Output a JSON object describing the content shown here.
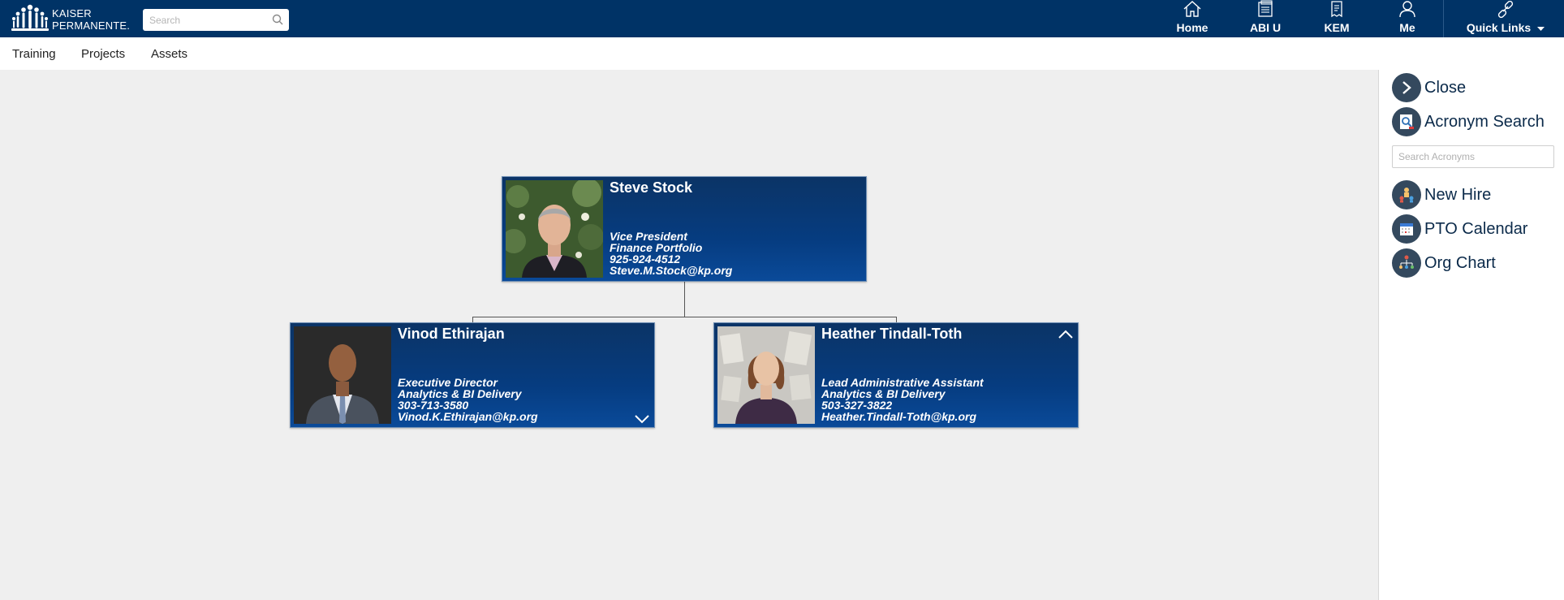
{
  "header": {
    "logo_line1": "KAISER",
    "logo_line2": "PERMANENTE.",
    "search_placeholder": "Search",
    "nav": [
      {
        "label": "Home",
        "icon": "home-icon"
      },
      {
        "label": "ABI U",
        "icon": "books-icon"
      },
      {
        "label": "KEM",
        "icon": "document-icon"
      },
      {
        "label": "Me",
        "icon": "user-icon"
      }
    ],
    "quick_links": {
      "label": "Quick Links",
      "icon": "link-icon"
    }
  },
  "subnav": {
    "items": [
      "Training",
      "Projects",
      "Assets"
    ]
  },
  "org_chart": {
    "root": {
      "name": "Steve Stock",
      "title": "Vice President",
      "department": "Finance Portfolio",
      "phone": "925-924-4512",
      "email": "Steve.M.Stock@kp.org"
    },
    "children": [
      {
        "name": "Vinod Ethirajan",
        "title": "Executive Director",
        "department": "Analytics & BI Delivery",
        "phone": "303-713-3580",
        "email": "Vinod.K.Ethirajan@kp.org",
        "toggle_icon": "chevron-down-icon"
      },
      {
        "name": "Heather Tindall-Toth",
        "title": "Lead Administrative Assistant",
        "department": "Analytics & BI Delivery",
        "phone": "503-327-3822",
        "email": "Heather.Tindall-Toth@kp.org",
        "toggle_icon": "chevron-up-icon"
      }
    ]
  },
  "side_panel": {
    "close_label": "Close",
    "acronym_search_label": "Acronym Search",
    "acronym_placeholder": "Search Acronyms",
    "new_hire_label": "New Hire",
    "pto_calendar_label": "PTO Calendar",
    "org_chart_label": "Org Chart"
  },
  "colors": {
    "header_bg": "#003366",
    "card_bg": "#063c80",
    "panel_icon_bg": "#34495e"
  }
}
